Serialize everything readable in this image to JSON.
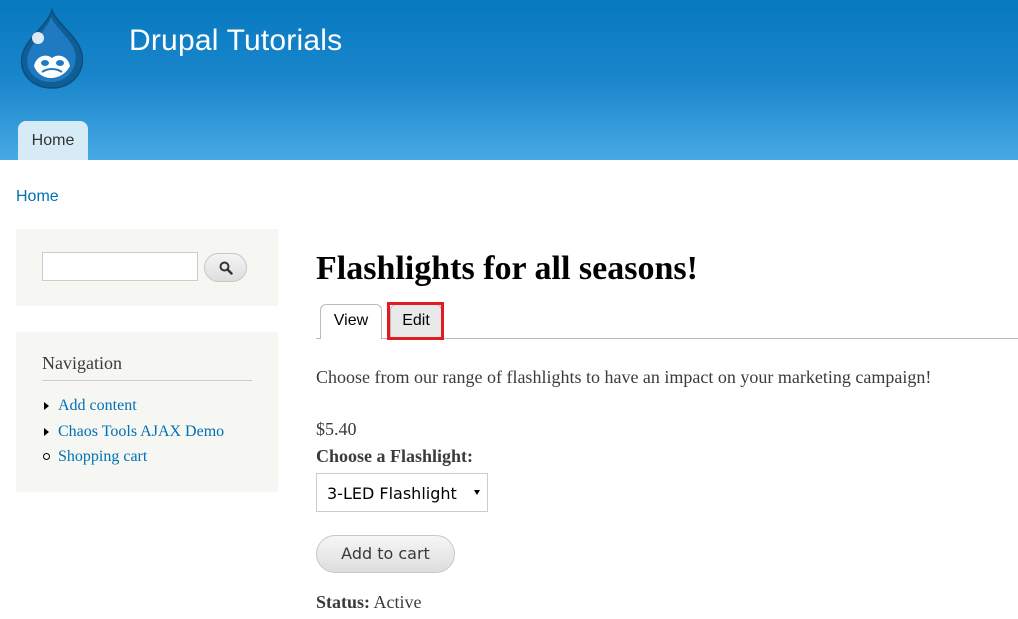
{
  "header": {
    "site_name": "Drupal Tutorials",
    "logo_icon": "drupal-drop-logo",
    "nav_tab": "Home",
    "colors": {
      "header_top": "#0779bf",
      "header_bottom": "#48a9e4",
      "active_tab": "#d7ebf7"
    }
  },
  "breadcrumb": {
    "home": "Home"
  },
  "search": {
    "input_value": "",
    "button_icon": "search-icon"
  },
  "navigation": {
    "title": "Navigation",
    "items": [
      {
        "label": "Add content",
        "bullet": "triangle"
      },
      {
        "label": "Chaos Tools AJAX Demo",
        "bullet": "triangle"
      },
      {
        "label": "Shopping cart",
        "bullet": "circle"
      }
    ]
  },
  "content": {
    "title": "Flashlights for all seasons!",
    "tabs": [
      {
        "label": "View",
        "active": true
      },
      {
        "label": "Edit",
        "active": false,
        "highlighted": true
      }
    ],
    "body": "Choose from our range of flashlights to have an impact on your marketing campaign!",
    "price": "$5.40",
    "select": {
      "label": "Choose a Flashlight:",
      "value": "3-LED Flashlight"
    },
    "add_to_cart": "Add to cart",
    "status": {
      "label": "Status:",
      "value": "Active"
    },
    "colors": {
      "link": "#0071b3",
      "highlight": "#e01b24"
    }
  }
}
